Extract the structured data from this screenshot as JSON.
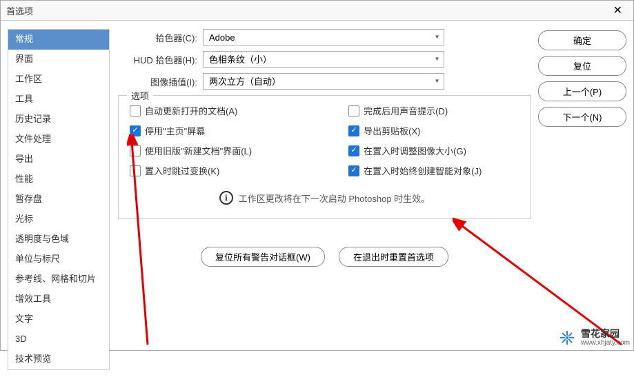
{
  "window": {
    "title": "首选项"
  },
  "sidebar": {
    "items": [
      "常规",
      "界面",
      "工作区",
      "工具",
      "历史记录",
      "文件处理",
      "导出",
      "性能",
      "暂存盘",
      "光标",
      "透明度与色域",
      "单位与标尺",
      "参考线、网格和切片",
      "增效工具",
      "文字",
      "3D",
      "技术预览"
    ],
    "selectedIndex": 0
  },
  "form": {
    "picker": {
      "label": "拾色器(C):",
      "value": "Adobe"
    },
    "hud": {
      "label": "HUD 拾色器(H):",
      "value": "色相条纹（小）"
    },
    "interp": {
      "label": "图像插值(I):",
      "value": "两次立方（自动）"
    }
  },
  "options": {
    "title": "选项",
    "left": [
      {
        "label": "自动更新打开的文档(A)",
        "checked": false
      },
      {
        "label": "停用\"主页\"屏幕",
        "checked": true
      },
      {
        "label": "使用旧版\"新建文档\"界面(L)",
        "checked": false
      },
      {
        "label": "置入时跳过变换(K)",
        "checked": false
      }
    ],
    "right": [
      {
        "label": "完成后用声音提示(D)",
        "checked": false
      },
      {
        "label": "导出剪贴板(X)",
        "checked": true
      },
      {
        "label": "在置入时调整图像大小(G)",
        "checked": true
      },
      {
        "label": "在置入时始终创建智能对象(J)",
        "checked": true
      }
    ],
    "info": "工作区更改将在下一次启动 Photoshop 时生效。",
    "resetWarnings": "复位所有警告对话框(W)",
    "resetOnQuit": "在退出时重置首选项"
  },
  "buttons": {
    "ok": "确定",
    "reset": "复位",
    "prev": "上一个(P)",
    "next": "下一个(N)"
  },
  "watermark": {
    "cn": "雪花家园",
    "en": "www.xhjaty.com"
  }
}
